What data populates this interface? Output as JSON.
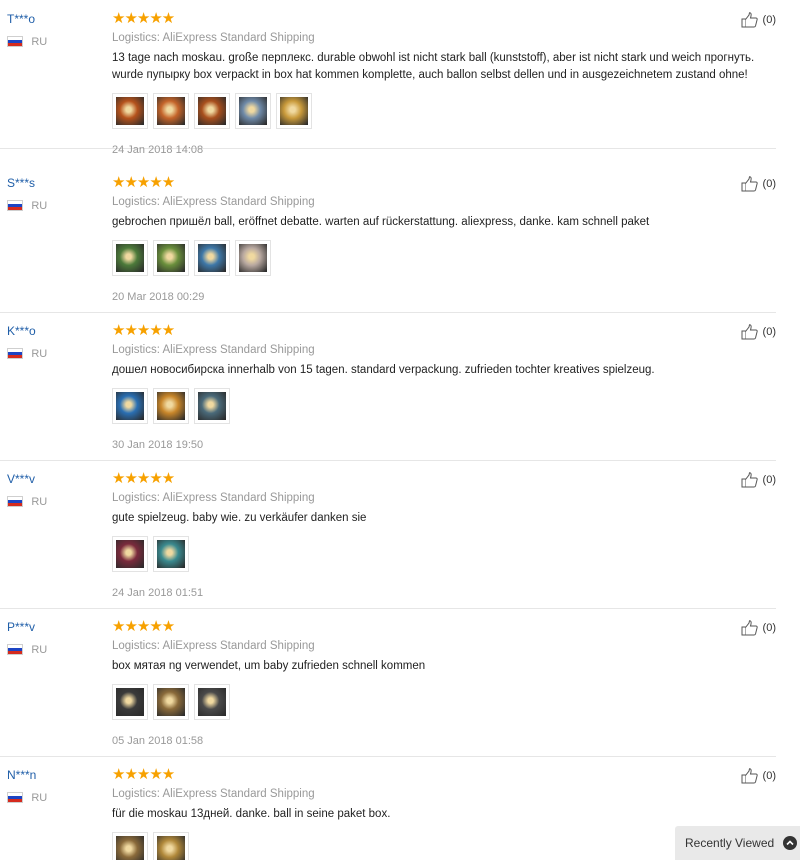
{
  "reviews": [
    {
      "user": "T***o",
      "country": "RU",
      "stars": "★★★★★",
      "logistics": "Logistics: AliExpress Standard Shipping",
      "text": "13 tage nach moskau. große перплекс. durable obwohl ist nicht stark ball (kunststoff), aber ist nicht stark und weich прогнуть. wurde пупырку box verpackt in box hat kommen komplette, auch ballon selbst dellen und in ausgezeichnetem zustand ohne!",
      "photos": [
        "#b5521c",
        "#c4642a",
        "#a84f1d",
        "#6f8aa8",
        "#c99a3b"
      ],
      "date": "24 Jan 2018 14:08",
      "helpful": "(0)"
    },
    {
      "user": "S***s",
      "country": "RU",
      "stars": "★★★★★",
      "logistics": "Logistics: AliExpress Standard Shipping",
      "text": "gebrochen пришёл ball, eröffnet debatte. warten auf rückerstattung. aliexpress, danke. kam schnell paket",
      "photos": [
        "#4c7a3a",
        "#6a8f3c",
        "#3e78a8",
        "#b8a8a0"
      ],
      "date": "20 Mar 2018 00:29",
      "helpful": "(0)"
    },
    {
      "user": "K***o",
      "country": "RU",
      "stars": "★★★★★",
      "logistics": "Logistics: AliExpress Standard Shipping",
      "text": "дошел новосибирска innerhalb von 15 tagen. standard verpackung. zufrieden tochter kreatives spielzeug.",
      "photos": [
        "#2a6fb3",
        "#c8862a",
        "#4a6a7a"
      ],
      "date": "30 Jan 2018 19:50",
      "helpful": "(0)"
    },
    {
      "user": "V***v",
      "country": "RU",
      "stars": "★★★★★",
      "logistics": "Logistics: AliExpress Standard Shipping",
      "text": "gute spielzeug. baby wie. zu verkäufer danken sie",
      "photos": [
        "#7a2a3c",
        "#3a8a8f"
      ],
      "date": "24 Jan 2018 01:51",
      "helpful": "(0)"
    },
    {
      "user": "P***v",
      "country": "RU",
      "stars": "★★★★★",
      "logistics": "Logistics: AliExpress Standard Shipping",
      "text": "box мятая ng verwendet, um baby zufrieden schnell kommen",
      "photos": [
        "#3a3a3a",
        "#8a6a3a",
        "#4a4a4a"
      ],
      "date": "05 Jan 2018 01:58",
      "helpful": "(0)"
    },
    {
      "user": "N***n",
      "country": "RU",
      "stars": "★★★★★",
      "logistics": "Logistics: AliExpress Standard Shipping",
      "text": "für die moskau 13дней. danke. ball in seine paket box.",
      "photos": [
        "#8a6a3a",
        "#b0883a"
      ],
      "date": "",
      "helpful": "(0)"
    }
  ],
  "recently_viewed": {
    "label": "Recently Viewed"
  },
  "colors": {
    "star": "#f7a100",
    "user": "#1f5ea8",
    "muted": "#999999"
  }
}
